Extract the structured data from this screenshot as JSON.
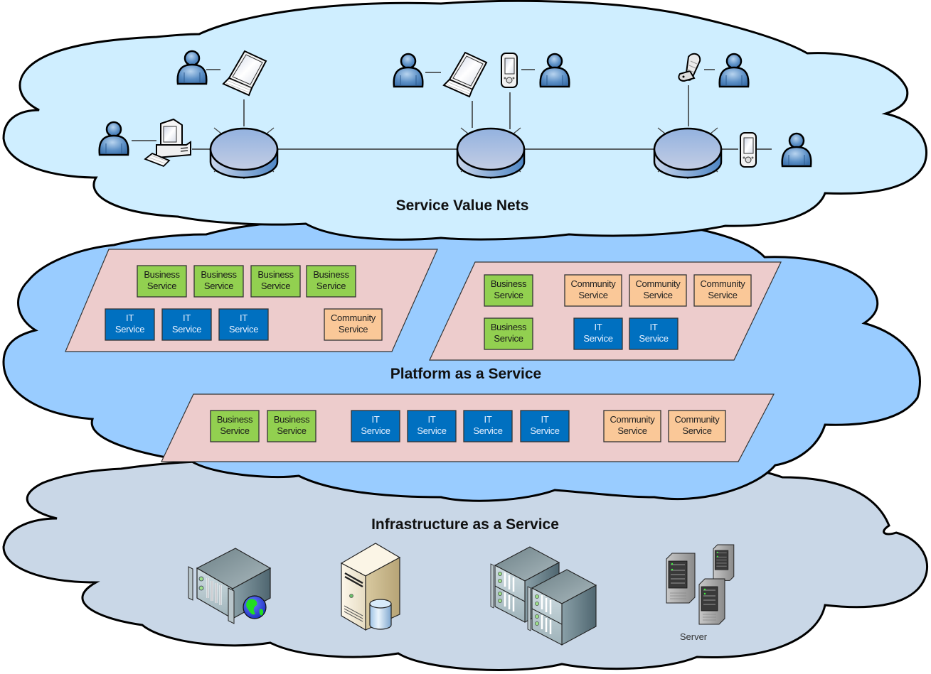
{
  "colors": {
    "cloud_top": "#cfeeff",
    "cloud_mid": "#99ccff",
    "cloud_bottom": "#c9d7e7",
    "outline": "#000000",
    "panel": "#edcccc",
    "business": "#92d050",
    "it": "#0070c0",
    "community": "#fac898",
    "business_text": "#1a1a1a",
    "it_text": "#e6f0ff",
    "community_text": "#222222"
  },
  "layers": {
    "service_value_nets": {
      "title": "Service Value Nets",
      "hubs": [
        {
          "name": "hub-left",
          "devices": [
            "user",
            "laptop",
            "user",
            "desktop-computer"
          ]
        },
        {
          "name": "hub-center",
          "devices": [
            "user",
            "laptop",
            "pda",
            "user"
          ]
        },
        {
          "name": "hub-right",
          "devices": [
            "cell-phone",
            "user",
            "pda",
            "user"
          ]
        }
      ]
    },
    "platform": {
      "title": "Platform as a Service",
      "panels": [
        {
          "name": "panel-top-left",
          "rows": [
            [
              {
                "type": "business",
                "line1": "Business",
                "line2": "Service"
              },
              {
                "type": "business",
                "line1": "Business",
                "line2": "Service"
              },
              {
                "type": "business",
                "line1": "Business",
                "line2": "Service"
              },
              {
                "type": "business",
                "line1": "Business",
                "line2": "Service"
              }
            ],
            [
              {
                "type": "it",
                "line1": "IT",
                "line2": "Service"
              },
              {
                "type": "it",
                "line1": "IT",
                "line2": "Service"
              },
              {
                "type": "it",
                "line1": "IT",
                "line2": "Service"
              },
              {
                "type": "community",
                "line1": "Community",
                "line2": "Service"
              }
            ]
          ]
        },
        {
          "name": "panel-top-right",
          "rows": [
            [
              {
                "type": "business",
                "line1": "Business",
                "line2": "Service"
              },
              {
                "type": "community",
                "line1": "Community",
                "line2": "Service"
              },
              {
                "type": "community",
                "line1": "Community",
                "line2": "Service"
              },
              {
                "type": "community",
                "line1": "Community",
                "line2": "Service"
              }
            ],
            [
              {
                "type": "business",
                "line1": "Business",
                "line2": "Service"
              },
              {
                "type": "it",
                "line1": "IT",
                "line2": "Service"
              },
              {
                "type": "it",
                "line1": "IT",
                "line2": "Service"
              }
            ]
          ]
        },
        {
          "name": "panel-bottom",
          "rows": [
            [
              {
                "type": "business",
                "line1": "Business",
                "line2": "Service"
              },
              {
                "type": "business",
                "line1": "Business",
                "line2": "Service"
              },
              {
                "type": "it",
                "line1": "IT",
                "line2": "Service"
              },
              {
                "type": "it",
                "line1": "IT",
                "line2": "Service"
              },
              {
                "type": "it",
                "line1": "IT",
                "line2": "Service"
              },
              {
                "type": "it",
                "line1": "IT",
                "line2": "Service"
              },
              {
                "type": "community",
                "line1": "Community",
                "line2": "Service"
              },
              {
                "type": "community",
                "line1": "Community",
                "line2": "Service"
              }
            ]
          ]
        }
      ]
    },
    "infrastructure": {
      "title": "Infrastructure as a Service",
      "items": [
        {
          "name": "web-server",
          "caption": ""
        },
        {
          "name": "database-server",
          "caption": ""
        },
        {
          "name": "rack-server-cluster",
          "caption": ""
        },
        {
          "name": "tower-servers",
          "caption": "Server"
        }
      ]
    }
  }
}
